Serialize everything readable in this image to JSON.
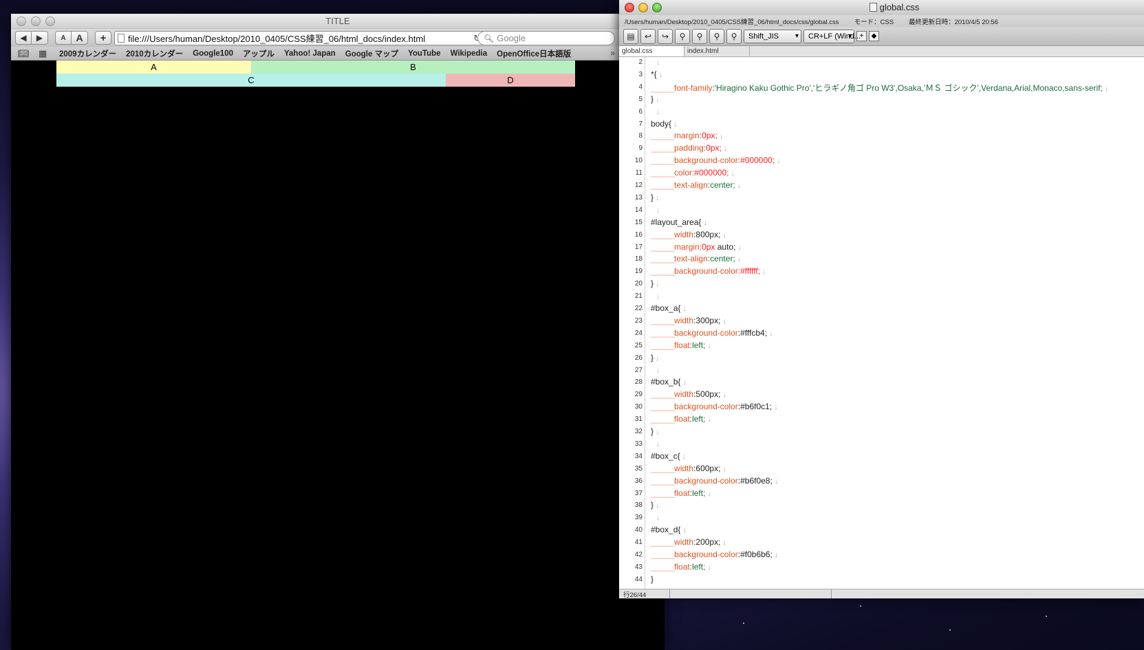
{
  "browser": {
    "title": "TITLE",
    "url": "file:///Users/human/Desktop/2010_0405/CSS練習_06/html_docs/index.html",
    "search_placeholder": "Google",
    "font_small_label": "A",
    "font_large_label": "A",
    "add_label": "+",
    "bookmarks": [
      "2009カレンダー",
      "2010カレンダー",
      "Google100",
      "アップル",
      "Yahoo! Japan",
      "Google マップ",
      "YouTube",
      "Wikipedia",
      "OpenOffice日本語版"
    ],
    "bookmarks_more": "»",
    "boxes": {
      "a": {
        "label": "A",
        "color": "#fffcb4"
      },
      "b": {
        "label": "B",
        "color": "#b6f0c1"
      },
      "c": {
        "label": "C",
        "color": "#b6f0e8"
      },
      "d": {
        "label": "D",
        "color": "#f0b6b6"
      }
    }
  },
  "editor": {
    "title": "global.css",
    "path": "/Users/human/Desktop/2010_0405/CSS練習_06/html_docs/css/global.css",
    "mode": "モード：CSS",
    "modified": "最終更新日時：2010/4/5 20:56",
    "encoding": "Shift_JIS",
    "line_ending": "CR+LF (Wind...",
    "tabs": [
      "global.css",
      "index.html"
    ],
    "status": "行26/44",
    "lines": [
      {
        "n": "2",
        "segs": []
      },
      {
        "n": "3",
        "segs": [
          {
            "t": "*{",
            "c": "dval"
          }
        ]
      },
      {
        "n": "4",
        "segs": [
          {
            "t": "______",
            "c": "indent"
          },
          {
            "t": "font-family",
            "c": "prop"
          },
          {
            "t": ":'Hiragino Kaku Gothic Pro','ヒラギノ角ゴ Pro W3',Osaka,'ＭＳ ゴシック',Verdana,Arial,Monaco,",
            "c": "val"
          },
          {
            "t": "sans-serif;",
            "c": "val"
          }
        ]
      },
      {
        "n": "5",
        "segs": [
          {
            "t": "}",
            "c": "dval"
          }
        ]
      },
      {
        "n": "6",
        "segs": []
      },
      {
        "n": "7",
        "segs": [
          {
            "t": "body{",
            "c": "dval"
          }
        ]
      },
      {
        "n": "8",
        "segs": [
          {
            "t": "______",
            "c": "indent"
          },
          {
            "t": "margin",
            "c": "prop"
          },
          {
            "t": ":0px;",
            "c": "redval"
          }
        ]
      },
      {
        "n": "9",
        "segs": [
          {
            "t": "______",
            "c": "indent"
          },
          {
            "t": "padding",
            "c": "prop"
          },
          {
            "t": ":0px;",
            "c": "redval"
          }
        ]
      },
      {
        "n": "10",
        "segs": [
          {
            "t": "______",
            "c": "indent"
          },
          {
            "t": "background-color",
            "c": "prop"
          },
          {
            "t": ":#000000;",
            "c": "redval"
          }
        ]
      },
      {
        "n": "11",
        "segs": [
          {
            "t": "______",
            "c": "indent"
          },
          {
            "t": "color",
            "c": "prop"
          },
          {
            "t": ":#000000;",
            "c": "redval"
          }
        ]
      },
      {
        "n": "12",
        "segs": [
          {
            "t": "______",
            "c": "indent"
          },
          {
            "t": "text-align",
            "c": "prop"
          },
          {
            "t": ":center;",
            "c": "val"
          }
        ]
      },
      {
        "n": "13",
        "segs": [
          {
            "t": "}",
            "c": "dval"
          }
        ]
      },
      {
        "n": "14",
        "segs": []
      },
      {
        "n": "15",
        "segs": [
          {
            "t": "#layout_area{",
            "c": "dval"
          }
        ]
      },
      {
        "n": "16",
        "segs": [
          {
            "t": "______",
            "c": "indent"
          },
          {
            "t": "width",
            "c": "prop"
          },
          {
            "t": ":800px;",
            "c": "dval"
          }
        ]
      },
      {
        "n": "17",
        "segs": [
          {
            "t": "______",
            "c": "indent"
          },
          {
            "t": "margin",
            "c": "prop"
          },
          {
            "t": ":0px ",
            "c": "redval"
          },
          {
            "t": "auto;",
            "c": "dval"
          }
        ]
      },
      {
        "n": "18",
        "segs": [
          {
            "t": "______",
            "c": "indent"
          },
          {
            "t": "text-align",
            "c": "prop"
          },
          {
            "t": ":center;",
            "c": "val"
          }
        ]
      },
      {
        "n": "19",
        "segs": [
          {
            "t": "______",
            "c": "indent"
          },
          {
            "t": "background-color",
            "c": "prop"
          },
          {
            "t": ":#ffffff;",
            "c": "redval"
          }
        ]
      },
      {
        "n": "20",
        "segs": [
          {
            "t": "}",
            "c": "dval"
          }
        ]
      },
      {
        "n": "21",
        "segs": []
      },
      {
        "n": "22",
        "segs": [
          {
            "t": "#box_a{",
            "c": "dval"
          }
        ]
      },
      {
        "n": "23",
        "segs": [
          {
            "t": "______",
            "c": "indent"
          },
          {
            "t": "width",
            "c": "prop"
          },
          {
            "t": ":300px;",
            "c": "dval"
          }
        ]
      },
      {
        "n": "24",
        "segs": [
          {
            "t": "______",
            "c": "indent"
          },
          {
            "t": "background-color",
            "c": "prop"
          },
          {
            "t": ":#fffcb4;",
            "c": "dval"
          }
        ]
      },
      {
        "n": "25",
        "segs": [
          {
            "t": "______",
            "c": "indent"
          },
          {
            "t": "float",
            "c": "prop"
          },
          {
            "t": ":left;",
            "c": "val"
          }
        ]
      },
      {
        "n": "26",
        "segs": [
          {
            "t": "}",
            "c": "dval"
          }
        ]
      },
      {
        "n": "27",
        "segs": []
      },
      {
        "n": "28",
        "segs": [
          {
            "t": "#box_b{",
            "c": "dval"
          }
        ]
      },
      {
        "n": "29",
        "segs": [
          {
            "t": "______",
            "c": "indent"
          },
          {
            "t": "width",
            "c": "prop"
          },
          {
            "t": ":500px;",
            "c": "dval"
          }
        ]
      },
      {
        "n": "30",
        "segs": [
          {
            "t": "______",
            "c": "indent"
          },
          {
            "t": "background-color",
            "c": "prop"
          },
          {
            "t": ":#b6f0c1;",
            "c": "dval"
          }
        ]
      },
      {
        "n": "31",
        "segs": [
          {
            "t": "______",
            "c": "indent"
          },
          {
            "t": "float",
            "c": "prop"
          },
          {
            "t": ":left;",
            "c": "val"
          }
        ]
      },
      {
        "n": "32",
        "segs": [
          {
            "t": "}",
            "c": "dval"
          }
        ]
      },
      {
        "n": "33",
        "segs": []
      },
      {
        "n": "34",
        "segs": [
          {
            "t": "#box_c{",
            "c": "dval"
          }
        ]
      },
      {
        "n": "35",
        "segs": [
          {
            "t": "______",
            "c": "indent"
          },
          {
            "t": "width",
            "c": "prop"
          },
          {
            "t": ":600px;",
            "c": "dval"
          }
        ]
      },
      {
        "n": "36",
        "segs": [
          {
            "t": "______",
            "c": "indent"
          },
          {
            "t": "background-color",
            "c": "prop"
          },
          {
            "t": ":#b6f0e8;",
            "c": "dval"
          }
        ]
      },
      {
        "n": "37",
        "segs": [
          {
            "t": "______",
            "c": "indent"
          },
          {
            "t": "float",
            "c": "prop"
          },
          {
            "t": ":left;",
            "c": "val"
          }
        ]
      },
      {
        "n": "38",
        "segs": [
          {
            "t": "}",
            "c": "dval"
          }
        ]
      },
      {
        "n": "39",
        "segs": []
      },
      {
        "n": "40",
        "segs": [
          {
            "t": "#box_d{",
            "c": "dval"
          }
        ]
      },
      {
        "n": "41",
        "segs": [
          {
            "t": "______",
            "c": "indent"
          },
          {
            "t": "width",
            "c": "prop"
          },
          {
            "t": ":200px;",
            "c": "dval"
          }
        ]
      },
      {
        "n": "42",
        "segs": [
          {
            "t": "______",
            "c": "indent"
          },
          {
            "t": "background-color",
            "c": "prop"
          },
          {
            "t": ":#f0b6b6;",
            "c": "dval"
          }
        ]
      },
      {
        "n": "43",
        "segs": [
          {
            "t": "______",
            "c": "indent"
          },
          {
            "t": "float",
            "c": "prop"
          },
          {
            "t": ":left;",
            "c": "val"
          }
        ]
      },
      {
        "n": "44",
        "segs": [
          {
            "t": "}",
            "c": "dval"
          }
        ]
      }
    ],
    "newline_mark": "↓"
  }
}
